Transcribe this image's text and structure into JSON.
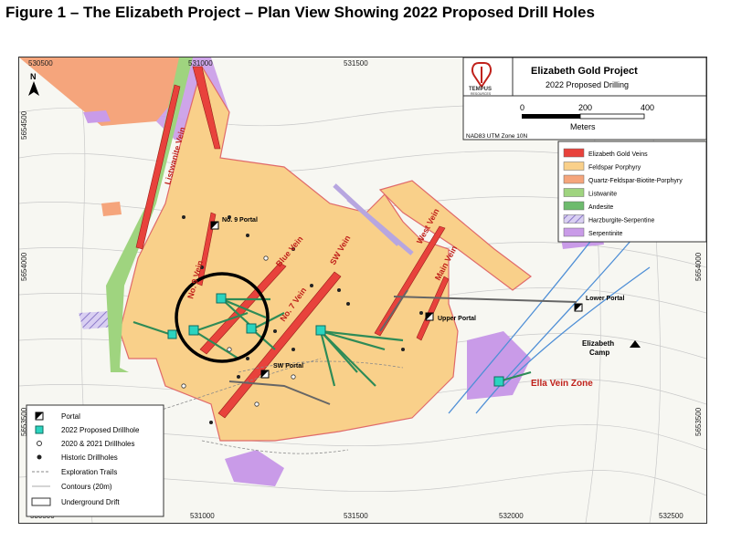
{
  "figure_title": "Figure 1 – The Elizabeth Project – Plan View Showing 2022 Proposed Drill Holes",
  "title_block": {
    "company": "TEMPUS",
    "company_sub": "RESOURCES",
    "project": "Elizabeth Gold Project",
    "subtitle": "2022 Proposed Drilling",
    "scale_labels": [
      "0",
      "200",
      "400"
    ],
    "scale_unit": "Meters",
    "datum": "NAD83 UTM Zone 10N",
    "north": "N"
  },
  "coords": {
    "x_top": [
      "530500",
      "531000",
      "531500"
    ],
    "x_bottom": [
      "530500",
      "531000",
      "531500",
      "532000",
      "532500"
    ],
    "y_left": [
      "5654500",
      "5654000",
      "5653500"
    ],
    "y_right": [
      "5654000",
      "5653500"
    ]
  },
  "geology_legend": [
    {
      "label": "Elizabeth Gold Veins",
      "color": "#e8423c"
    },
    {
      "label": "Feldspar Porphyry",
      "color": "#f9d08a"
    },
    {
      "label": "Quartz-Feldspar-Biotite-Porphyry",
      "color": "#f5a57c"
    },
    {
      "label": "Listwanite",
      "color": "#9fd47f"
    },
    {
      "label": "Andesite",
      "color": "#6dbb6d"
    },
    {
      "label": "Harzburgite-Serpentine",
      "color": "#b7a6e0"
    },
    {
      "label": "Serpentinite",
      "color": "#c99be8"
    }
  ],
  "symbol_legend": [
    "Portal",
    "2022 Proposed Drillhole",
    "2020 & 2021 Drillholes",
    "Historic Drillholes",
    "Exploration Trails",
    "Contours (20m)",
    "Underground Drift"
  ],
  "vein_labels": [
    "Listwanite Vein",
    "No. 9 Vein",
    "Blue Vein",
    "No. 7 Vein",
    "SW Vein",
    "West Vein",
    "Main Vein",
    "Ella Vein Zone"
  ],
  "portal_labels": [
    "No. 9 Portal",
    "SW Portal",
    "Upper Portal",
    "Lower Portal"
  ],
  "place_labels": [
    "Elizabeth",
    "Camp"
  ],
  "colors": {
    "vein": "#e8423c",
    "feldspar": "#f9d08a",
    "qfbp": "#f5a57c",
    "listwanite": "#9fd47f",
    "serpentinite": "#c99be8",
    "drillhole": "#2bd4c0",
    "drill_trace": "#2e8b57",
    "fault": "#4f8fd6",
    "thrust": "#e05a5a"
  }
}
